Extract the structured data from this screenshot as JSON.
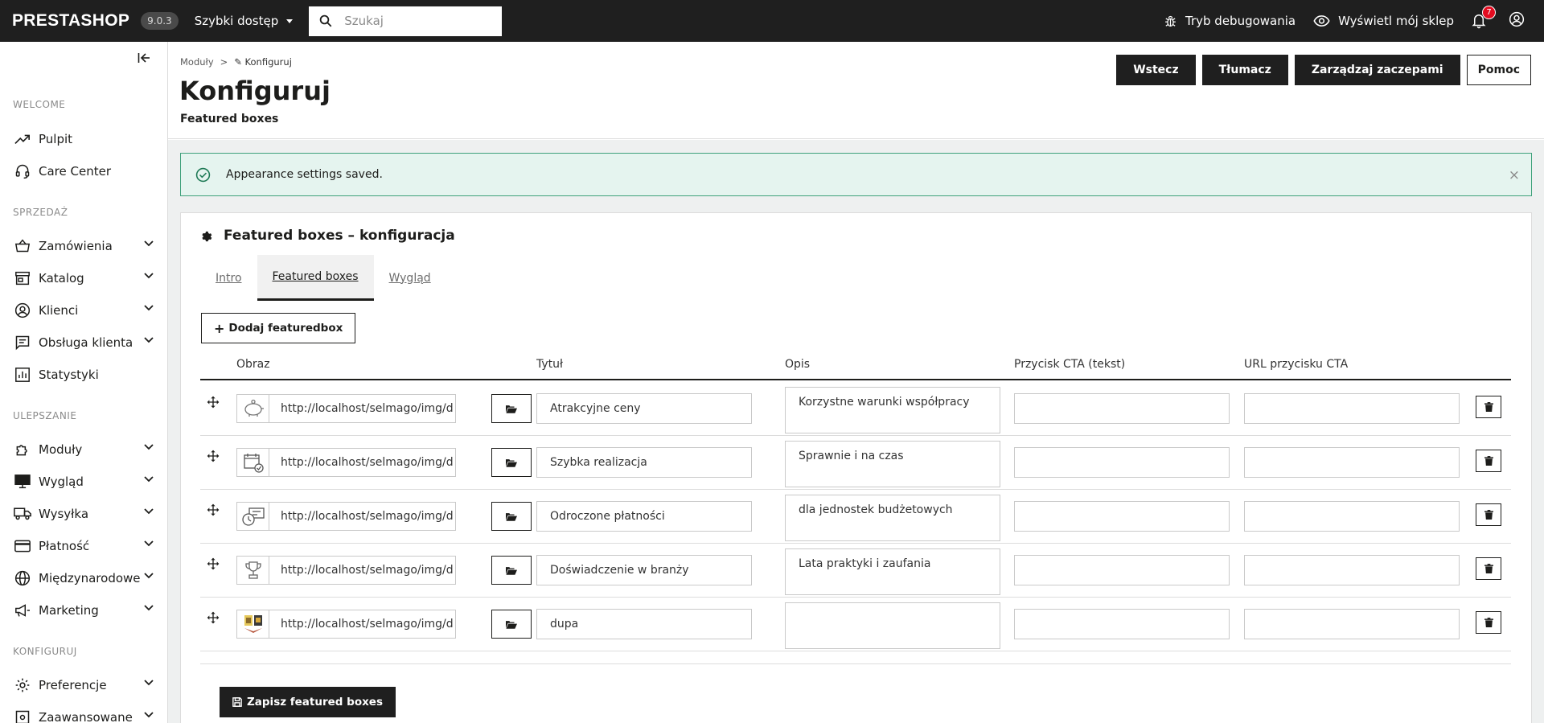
{
  "topbar": {
    "logo": "PRESTASHOP",
    "version": "9.0.3",
    "quick_access": "Szybki dostęp",
    "search_placeholder": "Szukaj",
    "debug_mode": "Tryb debugowania",
    "view_shop": "Wyświetl mój sklep",
    "notifications_count": "7"
  },
  "sidebar": {
    "sections": [
      "WELCOME",
      "SPRZEDAŻ",
      "ULEPSZANIE",
      "KONFIGURUJ"
    ],
    "items": [
      {
        "label": "Pulpit",
        "icon": "trending-up-icon"
      },
      {
        "label": "Care Center",
        "icon": "headset-icon"
      },
      {
        "label": "Zamówienia",
        "icon": "basket-icon"
      },
      {
        "label": "Katalog",
        "icon": "store-icon"
      },
      {
        "label": "Klienci",
        "icon": "account-circle-icon"
      },
      {
        "label": "Obsługa klienta",
        "icon": "chat-icon"
      },
      {
        "label": "Statystyki",
        "icon": "bar-chart-icon"
      },
      {
        "label": "Moduły",
        "icon": "puzzle-icon"
      },
      {
        "label": "Wygląd",
        "icon": "desktop-icon"
      },
      {
        "label": "Wysyłka",
        "icon": "truck-icon"
      },
      {
        "label": "Płatność",
        "icon": "credit-card-icon"
      },
      {
        "label": "Międzynarodowe",
        "icon": "globe-icon"
      },
      {
        "label": "Marketing",
        "icon": "megaphone-icon"
      },
      {
        "label": "Preferencje",
        "icon": "gear-icon"
      },
      {
        "label": "Zaawansowane",
        "icon": "settings-icon"
      }
    ]
  },
  "header": {
    "breadcrumb_parent": "Moduły",
    "breadcrumb_sep": ">",
    "breadcrumb_current": "✎ Konfiguruj",
    "title": "Konfiguruj",
    "subtitle": "Featured boxes",
    "buttons": {
      "back": "Wstecz",
      "translate": "Tłumacz",
      "hooks": "Zarządzaj zaczepami",
      "help": "Pomoc"
    }
  },
  "alert": {
    "message": "Appearance settings saved.",
    "close": "×"
  },
  "panel": {
    "title": "Featured boxes – konfiguracja",
    "tabs": [
      {
        "label": "Intro",
        "active": false
      },
      {
        "label": "Featured boxes",
        "active": true
      },
      {
        "label": "Wygląd",
        "active": false
      }
    ],
    "add_button": "Dodaj featuredbox",
    "columns": {
      "image": "Obraz",
      "title": "Tytuł",
      "description": "Opis",
      "cta_text": "Przycisk CTA (tekst)",
      "cta_url": "URL przycisku CTA"
    },
    "rows": [
      {
        "image_url": "http://localhost/selmago/img/d",
        "thumb": "piggy-bank-icon",
        "title": "Atrakcyjne ceny",
        "description": "Korzystne warunki współpracy",
        "cta_text": "",
        "cta_url": ""
      },
      {
        "image_url": "http://localhost/selmago/img/d",
        "thumb": "calendar-check-icon",
        "title": "Szybka realizacja",
        "description": "Sprawnie i na czas",
        "cta_text": "",
        "cta_url": ""
      },
      {
        "image_url": "http://localhost/selmago/img/d",
        "thumb": "deferred-payment-icon",
        "title": "Odroczone płatności",
        "description": "dla jednostek budżetowych",
        "cta_text": "",
        "cta_url": ""
      },
      {
        "image_url": "http://localhost/selmago/img/d",
        "thumb": "trophy-icon",
        "title": "Doświadczenie w branży",
        "description": "Lata praktyki i zaufania",
        "cta_text": "",
        "cta_url": ""
      },
      {
        "image_url": "http://localhost/selmago/img/d",
        "thumb": "photo-thumbnail-icon",
        "title": "dupa",
        "description": "",
        "cta_text": "",
        "cta_url": ""
      }
    ],
    "save_button": "Zapisz featured boxes"
  }
}
